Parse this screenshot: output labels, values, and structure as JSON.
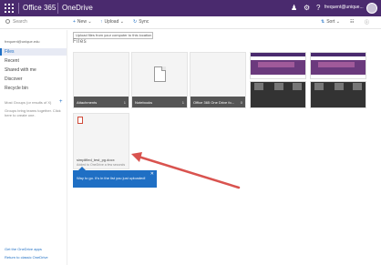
{
  "appbar": {
    "brand": "Office 365",
    "app_name": "OneDrive",
    "user": "frequent@unique...",
    "icons": {
      "bell": "bell-icon",
      "settings": "gear-icon",
      "help": "help-icon"
    },
    "colors": {
      "bar": "#4a2a6e"
    }
  },
  "search": {
    "placeholder": "Search"
  },
  "commands": {
    "new": "New",
    "upload": "Upload",
    "sync": "Sync"
  },
  "right_tools": {
    "sort": "Sort"
  },
  "sidebar": {
    "account": "frequent@unique.edu",
    "items": [
      {
        "label": "Files"
      },
      {
        "label": "Recent"
      },
      {
        "label": "Shared with me"
      },
      {
        "label": "Discover"
      },
      {
        "label": "Recycle bin"
      }
    ],
    "recent_header": "Most Groups (or results of X)",
    "group_hint": "Groups bring teams together. Click here to create one.",
    "footer": {
      "apps": "Get the OneDrive apps",
      "return": "Return to classic OneDrive"
    }
  },
  "tooltip": "Upload files from your computer to this location",
  "main": {
    "title": "Files"
  },
  "tiles": [
    {
      "label": "Attachments",
      "count": "1"
    },
    {
      "label": "Notebooks",
      "count": "1"
    },
    {
      "label": "Office 365 One Drive fo...",
      "count": "0"
    }
  ],
  "file": {
    "name": "simplified_test_pg.docx",
    "meta": "Added to OneDrive a few seconds"
  },
  "callout": {
    "message": "Way to go. It's in the list you just uploaded!"
  },
  "accent": {
    "blue": "#1f6fc4",
    "arrow": "#d9534f"
  }
}
